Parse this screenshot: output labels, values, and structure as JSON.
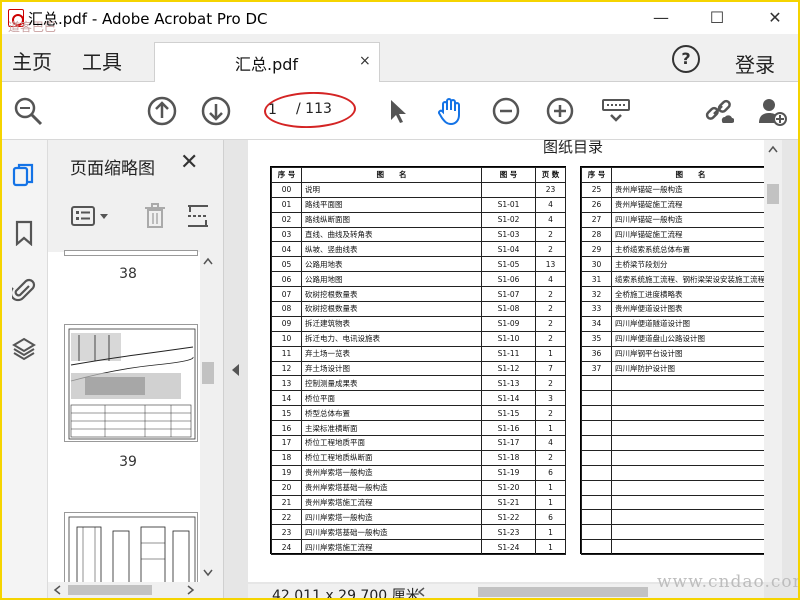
{
  "window": {
    "title": "汇总.pdf - Adobe Acrobat Pro DC",
    "minimize": "—",
    "maximize": "☐",
    "close": "✕"
  },
  "tabs": {
    "home": "主页",
    "tools": "工具",
    "document": "汇总.pdf",
    "document_close": "×",
    "help": "?",
    "login": "登录"
  },
  "toolbar": {
    "current_page": "1",
    "total_pages": "/ 113"
  },
  "thumbnails": {
    "title": "页面缩略图",
    "close": "✕",
    "pages": [
      "38",
      "39"
    ]
  },
  "document": {
    "heading": "图纸目录",
    "headers": [
      "序 号",
      "图　　名",
      "图 号",
      "页 数"
    ],
    "left_rows": [
      [
        "00",
        "说明",
        "",
        "23"
      ],
      [
        "01",
        "路线平面图",
        "S1-01",
        "4"
      ],
      [
        "02",
        "路线纵断面图",
        "S1-02",
        "4"
      ],
      [
        "03",
        "直线、曲线及转角表",
        "S1-03",
        "2"
      ],
      [
        "04",
        "纵坡、竖曲线表",
        "S1-04",
        "2"
      ],
      [
        "05",
        "公路用地表",
        "S1-05",
        "13"
      ],
      [
        "06",
        "公路用地图",
        "S1-06",
        "4"
      ],
      [
        "07",
        "砍树挖根数量表",
        "S1-07",
        "2"
      ],
      [
        "08",
        "砍树挖根数量表",
        "S1-08",
        "2"
      ],
      [
        "09",
        "拆迁建筑物表",
        "S1-09",
        "2"
      ],
      [
        "10",
        "拆迁电力、电讯设施表",
        "S1-10",
        "2"
      ],
      [
        "11",
        "弃土场一览表",
        "S1-11",
        "1"
      ],
      [
        "12",
        "弃土场设计图",
        "S1-12",
        "7"
      ],
      [
        "13",
        "控制测量成果表",
        "S1-13",
        "2"
      ],
      [
        "14",
        "桥位平面",
        "S1-14",
        "3"
      ],
      [
        "15",
        "桥型总体布置",
        "S1-15",
        "2"
      ],
      [
        "16",
        "主梁标准横断面",
        "S1-16",
        "1"
      ],
      [
        "17",
        "桥位工程地质平面",
        "S1-17",
        "4"
      ],
      [
        "18",
        "桥位工程地质纵断面",
        "S1-18",
        "2"
      ],
      [
        "19",
        "贵州岸索塔一般构造",
        "S1-19",
        "6"
      ],
      [
        "20",
        "贵州岸索塔基础一般构造",
        "S1-20",
        "1"
      ],
      [
        "21",
        "贵州岸索塔施工流程",
        "S1-21",
        "1"
      ],
      [
        "22",
        "四川岸索塔一般构造",
        "S1-22",
        "6"
      ],
      [
        "23",
        "四川岸索塔基础一般构造",
        "S1-23",
        "1"
      ],
      [
        "24",
        "四川岸索塔施工流程",
        "S1-24",
        "1"
      ]
    ],
    "right_headers": [
      "序 号",
      "图　　名"
    ],
    "right_rows": [
      [
        "25",
        "贵州岸锚碇一般构造"
      ],
      [
        "26",
        "贵州岸锚碇施工流程"
      ],
      [
        "27",
        "四川岸锚碇一般构造"
      ],
      [
        "28",
        "四川岸锚碇施工流程"
      ],
      [
        "29",
        "主桥缆索系统总体布置"
      ],
      [
        "30",
        "主桥梁节段划分"
      ],
      [
        "31",
        "缆索系统施工流程、钢桁梁架设安装施工流程"
      ],
      [
        "32",
        "全桥施工进度横略表"
      ],
      [
        "33",
        "贵州岸便道设计图表"
      ],
      [
        "34",
        "四川岸便道隧道设计图"
      ],
      [
        "35",
        "四川岸便道盘山公路设计图"
      ],
      [
        "36",
        "四川岸钢平台设计图"
      ],
      [
        "37",
        "四川岸防护设计图"
      ]
    ],
    "dimensions": "42.011 x 29.700 厘米"
  },
  "watermark": "www.cndao.com",
  "watermark_small": "道客巴巴",
  "colors": {
    "frame": "#f5d400",
    "accent_blue": "#1473e6",
    "annotation_red": "#d42424"
  }
}
